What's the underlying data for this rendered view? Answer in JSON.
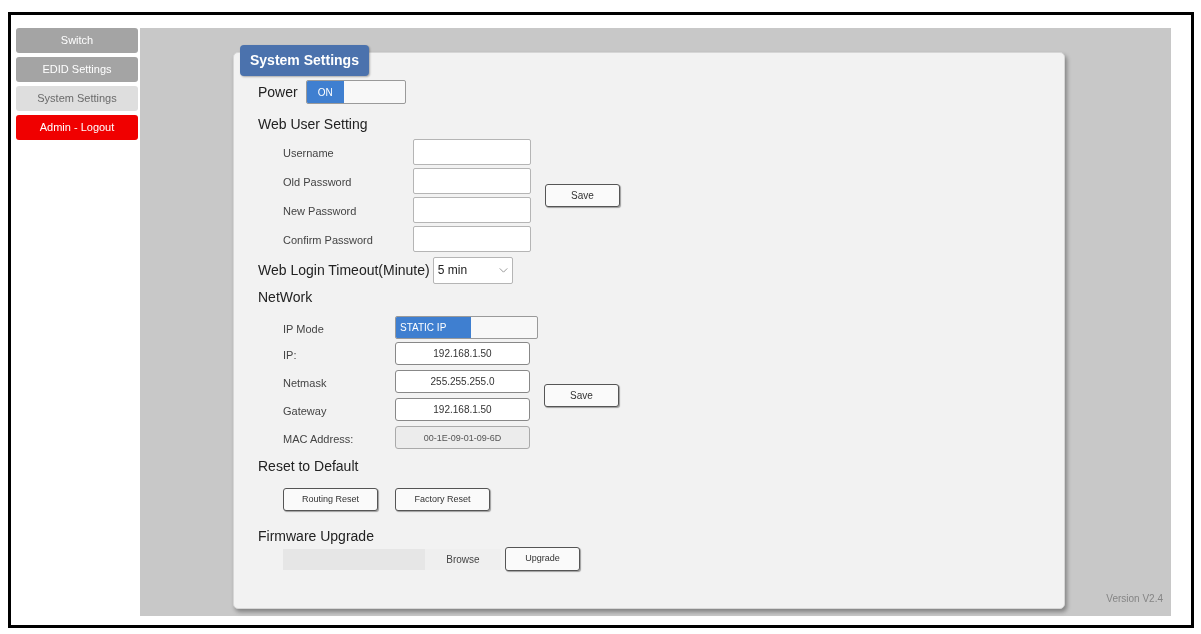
{
  "sidebar": {
    "items": [
      {
        "label": "Switch",
        "kind": "nav",
        "selected": false
      },
      {
        "label": "EDID Settings",
        "kind": "nav",
        "selected": false
      },
      {
        "label": "System Settings",
        "kind": "nav",
        "selected": true
      },
      {
        "label": "Admin - Logout",
        "kind": "logout",
        "selected": false
      }
    ]
  },
  "panel": {
    "tab": "System Settings"
  },
  "power": {
    "label": "Power",
    "toggle": {
      "text": "ON",
      "on": true
    }
  },
  "web_user": {
    "heading": "Web User Setting",
    "fields": [
      {
        "label": "Username"
      },
      {
        "label": "Old Password"
      },
      {
        "label": "New Password"
      },
      {
        "label": "Confirm Password"
      }
    ],
    "save_button": "Save"
  },
  "login_timeout": {
    "label": "Web Login Timeout(Minute)",
    "value": "5 min"
  },
  "network": {
    "heading": "NetWork",
    "ip_mode": {
      "label": "IP Mode",
      "toggle": {
        "text": "STATIC IP",
        "on": true
      }
    },
    "fields": [
      {
        "label": "IP:",
        "value": "192.168.1.50",
        "disabled": false
      },
      {
        "label": "Netmask",
        "value": "255.255.255.0",
        "disabled": false
      },
      {
        "label": "Gateway",
        "value": "192.168.1.50",
        "disabled": false
      },
      {
        "label": "MAC Address:",
        "value": "00-1E-09-01-09-6D",
        "disabled": true
      }
    ],
    "save_button": "Save"
  },
  "reset": {
    "heading": "Reset to Default",
    "buttons": [
      "Routing Reset",
      "Factory Reset"
    ]
  },
  "firmware": {
    "heading": "Firmware Upgrade",
    "browse_button": "Browse",
    "upgrade_button": "Upgrade"
  },
  "version": "Version V2.4"
}
